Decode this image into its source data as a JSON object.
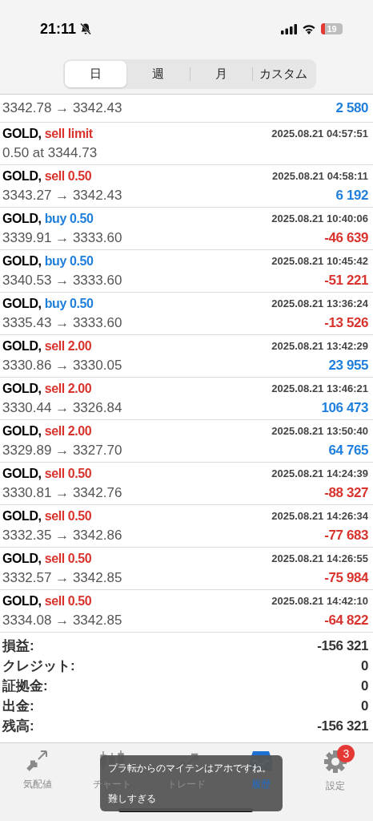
{
  "status_bar": {
    "time": "21:11",
    "battery": "19"
  },
  "period_tabs": [
    {
      "label": "日",
      "selected": true
    },
    {
      "label": "週",
      "selected": false
    },
    {
      "label": "月",
      "selected": false
    },
    {
      "label": "カスタム",
      "selected": false
    }
  ],
  "history": [
    {
      "kind": "partial",
      "prices": "3342.78 → 3342.43",
      "profit": "2 580",
      "positive": true
    },
    {
      "kind": "order",
      "symbol": "GOLD,",
      "side": "sell",
      "detail": "limit",
      "time": "2025.08.21 04:57:51",
      "prices": "0.50 at 3344.73"
    },
    {
      "kind": "deal",
      "symbol": "GOLD,",
      "side": "sell",
      "detail": "0.50",
      "time": "2025.08.21 04:58:11",
      "prices": "3343.27 → 3342.43",
      "profit": "6 192",
      "positive": true
    },
    {
      "kind": "deal",
      "symbol": "GOLD,",
      "side": "buy",
      "detail": "0.50",
      "time": "2025.08.21 10:40:06",
      "prices": "3339.91 → 3333.60",
      "profit": "-46 639",
      "positive": false
    },
    {
      "kind": "deal",
      "symbol": "GOLD,",
      "side": "buy",
      "detail": "0.50",
      "time": "2025.08.21 10:45:42",
      "prices": "3340.53 → 3333.60",
      "profit": "-51 221",
      "positive": false
    },
    {
      "kind": "deal",
      "symbol": "GOLD,",
      "side": "buy",
      "detail": "0.50",
      "time": "2025.08.21 13:36:24",
      "prices": "3335.43 → 3333.60",
      "profit": "-13 526",
      "positive": false
    },
    {
      "kind": "deal",
      "symbol": "GOLD,",
      "side": "sell",
      "detail": "2.00",
      "time": "2025.08.21 13:42:29",
      "prices": "3330.86 → 3330.05",
      "profit": "23 955",
      "positive": true
    },
    {
      "kind": "deal",
      "symbol": "GOLD,",
      "side": "sell",
      "detail": "2.00",
      "time": "2025.08.21 13:46:21",
      "prices": "3330.44 → 3326.84",
      "profit": "106 473",
      "positive": true
    },
    {
      "kind": "deal",
      "symbol": "GOLD,",
      "side": "sell",
      "detail": "2.00",
      "time": "2025.08.21 13:50:40",
      "prices": "3329.89 → 3327.70",
      "profit": "64 765",
      "positive": true
    },
    {
      "kind": "deal",
      "symbol": "GOLD,",
      "side": "sell",
      "detail": "0.50",
      "time": "2025.08.21 14:24:39",
      "prices": "3330.81 → 3342.76",
      "profit": "-88 327",
      "positive": false
    },
    {
      "kind": "deal",
      "symbol": "GOLD,",
      "side": "sell",
      "detail": "0.50",
      "time": "2025.08.21 14:26:34",
      "prices": "3332.35 → 3342.86",
      "profit": "-77 683",
      "positive": false
    },
    {
      "kind": "deal",
      "symbol": "GOLD,",
      "side": "sell",
      "detail": "0.50",
      "time": "2025.08.21 14:26:55",
      "prices": "3332.57 → 3342.85",
      "profit": "-75 984",
      "positive": false
    },
    {
      "kind": "deal",
      "symbol": "GOLD,",
      "side": "sell",
      "detail": "0.50",
      "time": "2025.08.21 14:42:10",
      "prices": "3334.08 → 3342.85",
      "profit": "-64 822",
      "positive": false
    }
  ],
  "summary": [
    {
      "label": "損益:",
      "value": "-156 321"
    },
    {
      "label": "クレジット:",
      "value": "0"
    },
    {
      "label": "証拠金:",
      "value": "0"
    },
    {
      "label": "出金:",
      "value": "0"
    },
    {
      "label": "残高:",
      "value": "-156 321"
    }
  ],
  "tab_bar": [
    {
      "kind": "quotes",
      "label": "気配値",
      "selected": false
    },
    {
      "kind": "chart",
      "label": "チャート",
      "selected": false
    },
    {
      "kind": "trade",
      "label": "トレード",
      "selected": false
    },
    {
      "kind": "history",
      "label": "履歴",
      "selected": true
    },
    {
      "kind": "settings",
      "label": "設定",
      "selected": false,
      "badge": "3"
    }
  ],
  "toast": {
    "message": "プラ転からのマイテンはアホですね。",
    "action": "難しすぎる"
  }
}
